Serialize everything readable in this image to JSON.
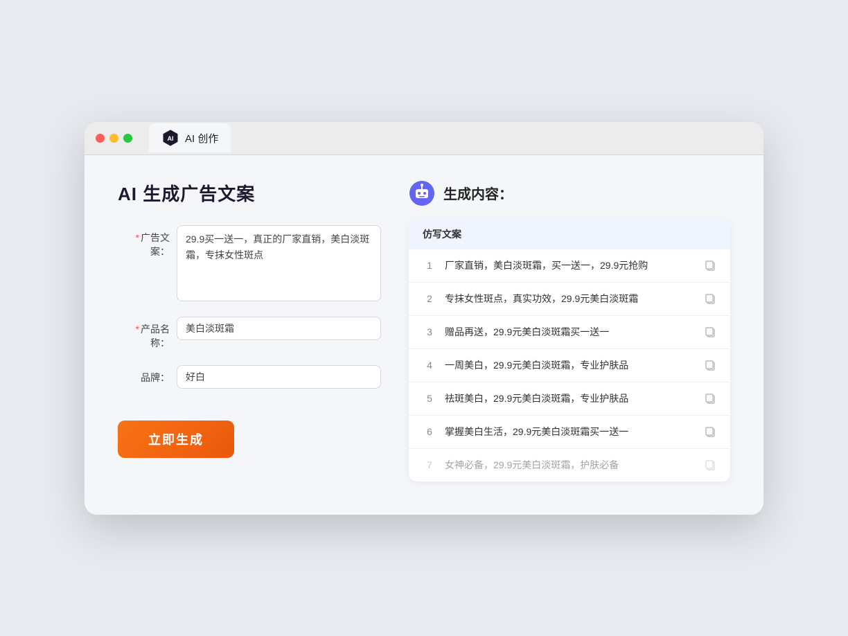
{
  "window": {
    "tab_label": "AI 创作"
  },
  "page": {
    "title": "AI 生成广告文案",
    "right_title": "生成内容："
  },
  "form": {
    "ad_copy_label": "广告文案：",
    "ad_copy_required": true,
    "ad_copy_value": "29.9买一送一，真正的厂家直销，美白淡斑霜，专抹女性斑点",
    "product_name_label": "产品名称：",
    "product_name_required": true,
    "product_name_value": "美白淡斑霜",
    "brand_label": "品牌：",
    "brand_required": false,
    "brand_value": "好白",
    "generate_button": "立即生成"
  },
  "results": {
    "header": "仿写文案",
    "items": [
      {
        "num": "1",
        "text": "厂家直销，美白淡斑霜，买一送一，29.9元抢购",
        "faded": false
      },
      {
        "num": "2",
        "text": "专抹女性斑点，真实功效，29.9元美白淡斑霜",
        "faded": false
      },
      {
        "num": "3",
        "text": "赠品再送，29.9元美白淡斑霜买一送一",
        "faded": false
      },
      {
        "num": "4",
        "text": "一周美白，29.9元美白淡斑霜，专业护肤品",
        "faded": false
      },
      {
        "num": "5",
        "text": "祛斑美白，29.9元美白淡斑霜，专业护肤品",
        "faded": false
      },
      {
        "num": "6",
        "text": "掌握美白生活，29.9元美白淡斑霜买一送一",
        "faded": false
      },
      {
        "num": "7",
        "text": "女神必备，29.9元美白淡斑霜，护肤必备",
        "faded": true
      }
    ]
  }
}
